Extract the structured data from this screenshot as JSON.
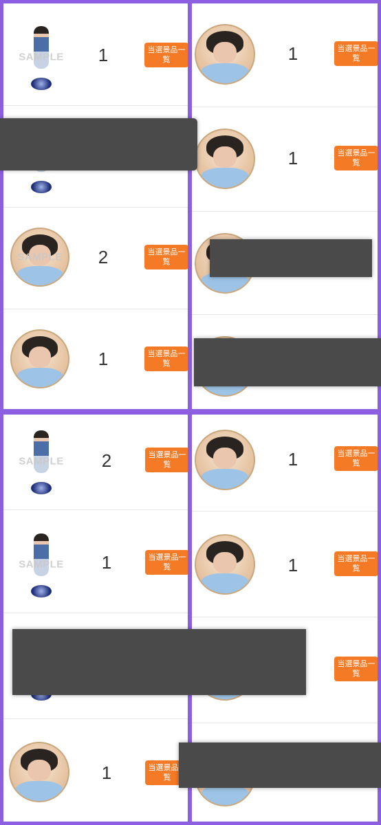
{
  "button_label": "当選景品一覧",
  "sample_text": "SAMPLE",
  "panels": {
    "top_left": {
      "rows": [
        {
          "type": "standee",
          "count": "1"
        },
        {
          "type": "standee",
          "count": ""
        },
        {
          "type": "circle",
          "count": "2"
        },
        {
          "type": "circle",
          "count": "1"
        }
      ]
    },
    "top_right": {
      "rows": [
        {
          "type": "circle",
          "count": "1"
        },
        {
          "type": "circle",
          "count": "1"
        },
        {
          "type": "circle",
          "count": ""
        },
        {
          "type": "circle",
          "count": ""
        }
      ]
    },
    "bottom_left": {
      "rows": [
        {
          "type": "standee",
          "count": "2"
        },
        {
          "type": "standee",
          "count": "1"
        },
        {
          "type": "standee",
          "count": ""
        },
        {
          "type": "circle",
          "count": "1"
        }
      ]
    },
    "bottom_right": {
      "rows": [
        {
          "type": "circle",
          "count": "1"
        },
        {
          "type": "circle",
          "count": "1"
        },
        {
          "type": "circle",
          "count": ""
        },
        {
          "type": "circle",
          "count": ""
        }
      ]
    }
  },
  "colors": {
    "frame": "#8b5fe0",
    "button": "#f47a26",
    "redaction": "#4a4a4a"
  }
}
